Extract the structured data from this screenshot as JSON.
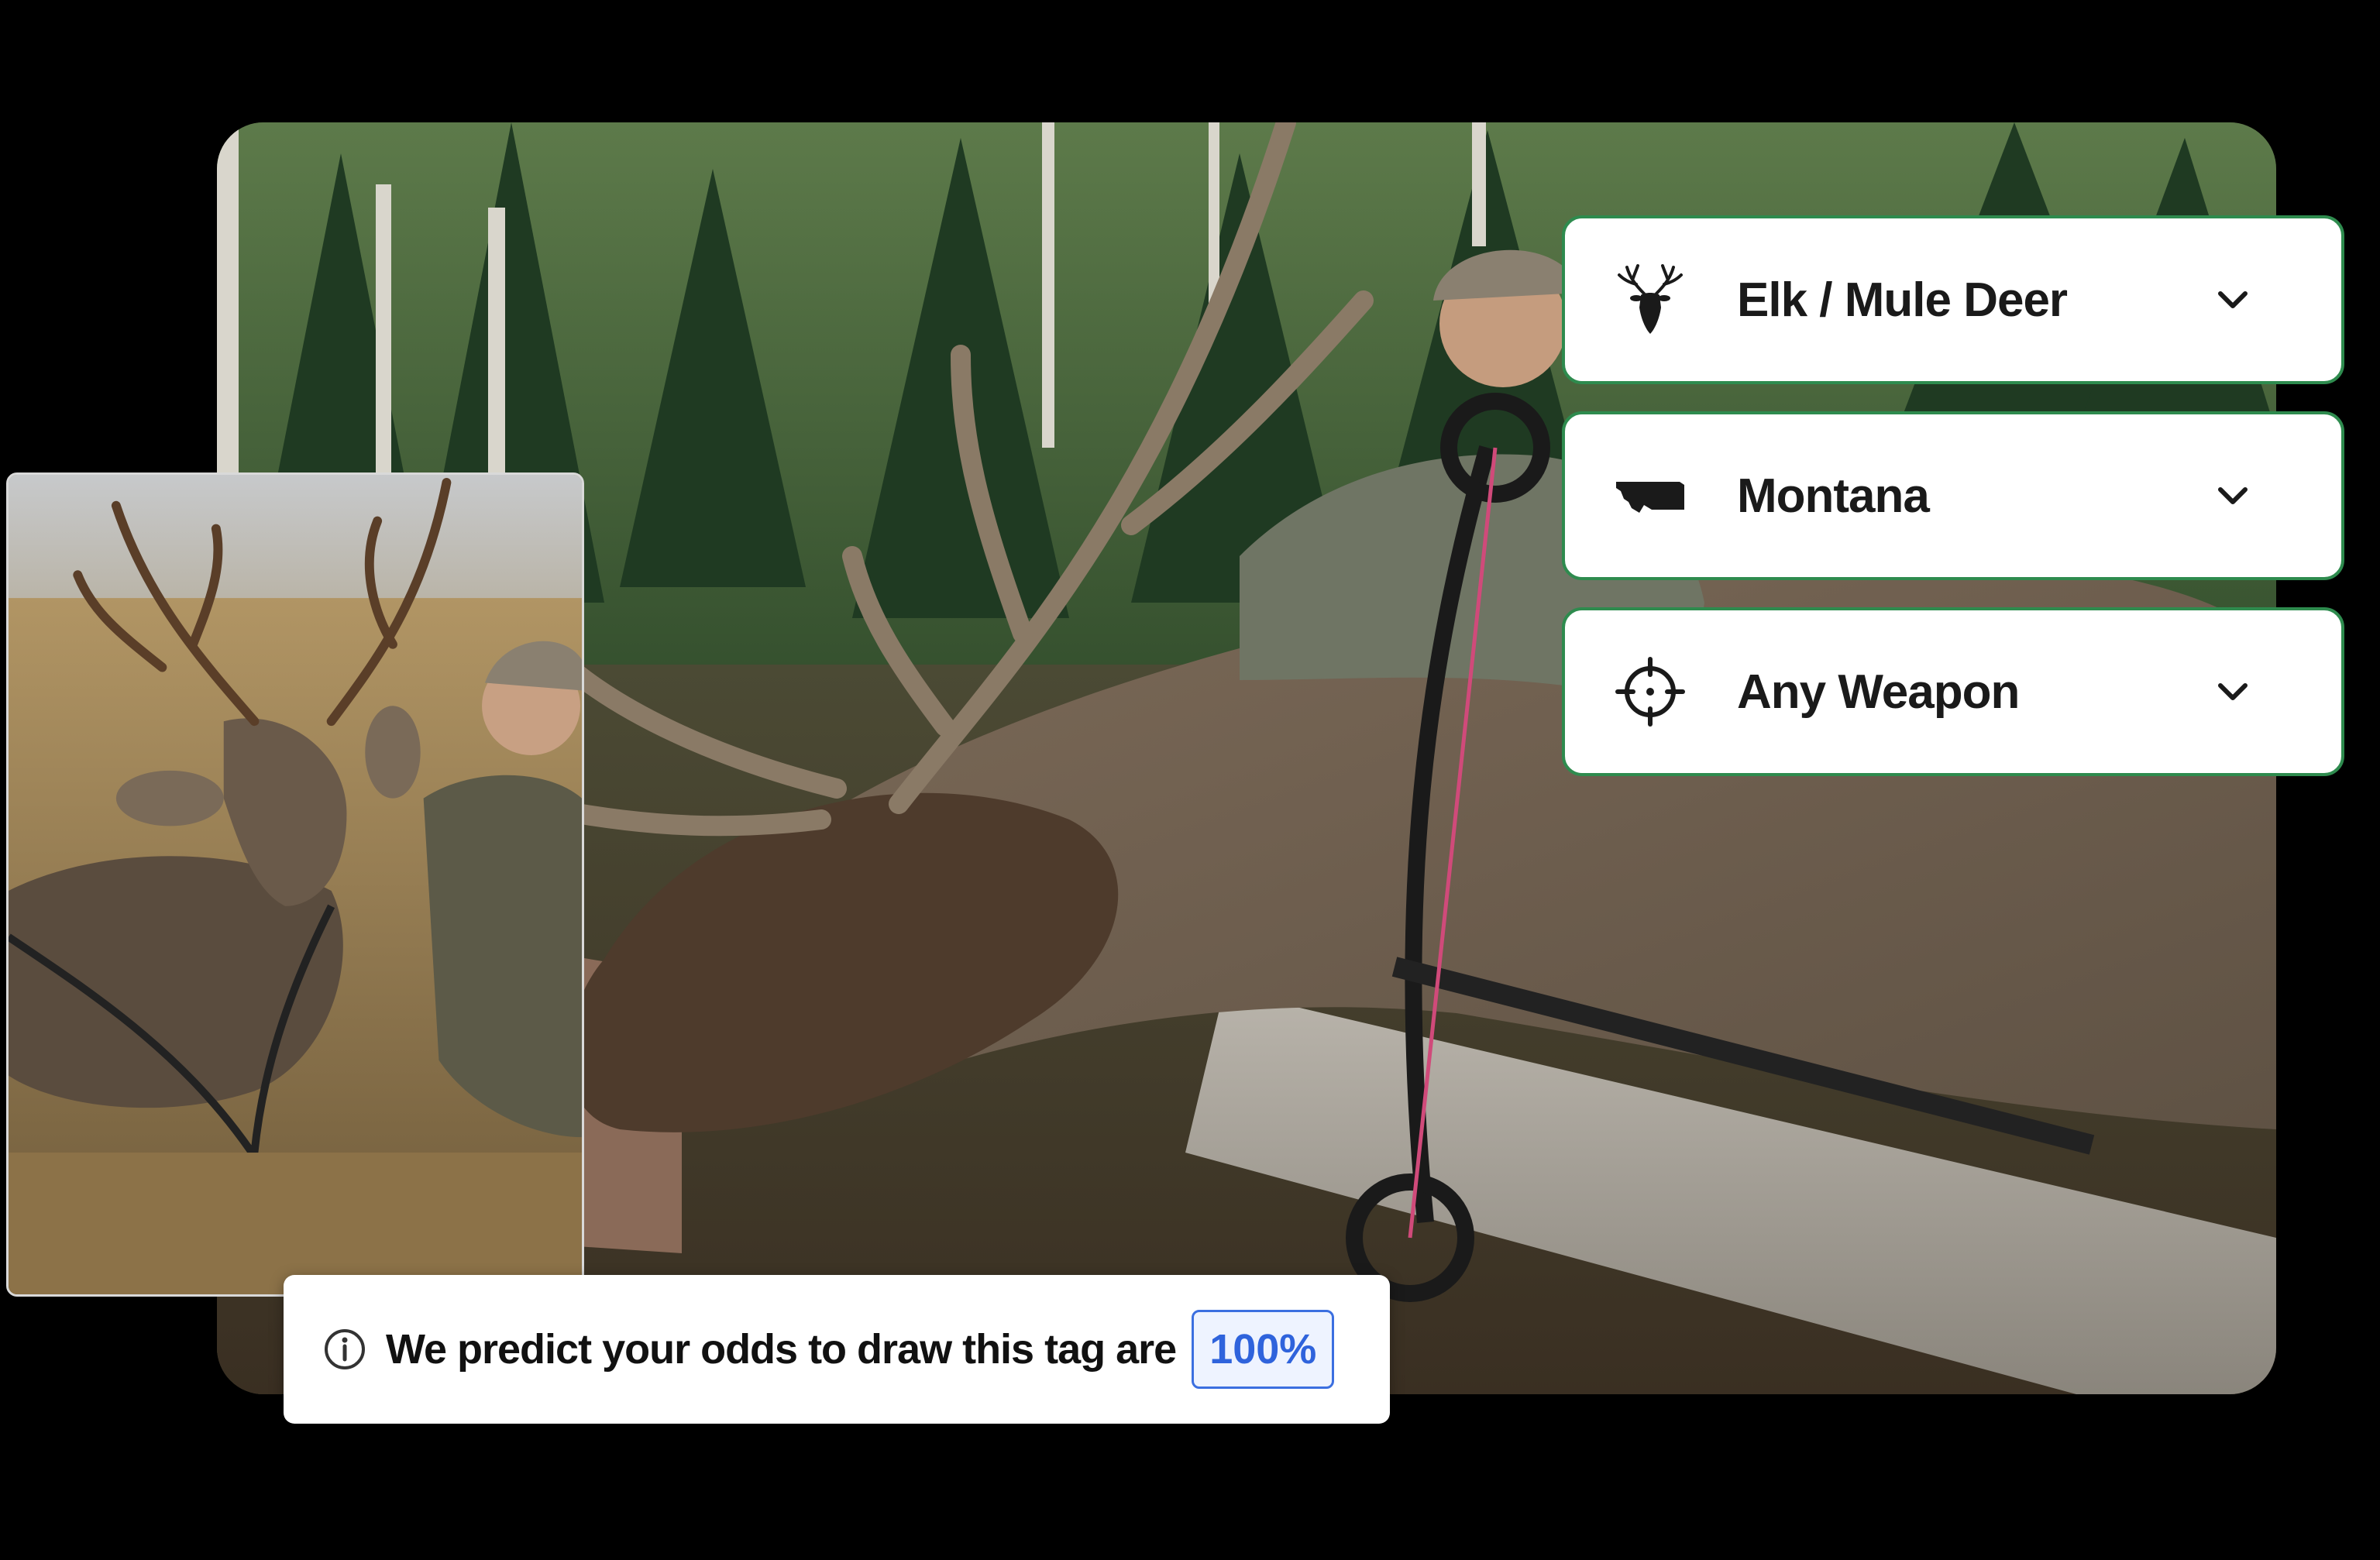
{
  "filters": {
    "species": {
      "label": "Elk / Mule Deer",
      "icon": "deer-head-icon"
    },
    "state": {
      "label": "Montana",
      "icon": "montana-state-icon"
    },
    "weapon": {
      "label": "Any Weapon",
      "icon": "crosshair-icon"
    }
  },
  "odds": {
    "text": "We predict your odds to draw this tag are",
    "value": "100%",
    "icon": "info-icon"
  },
  "colors": {
    "dropdown_border": "#2e8b4e",
    "odds_accent": "#2f63dc",
    "background": "#000000"
  }
}
